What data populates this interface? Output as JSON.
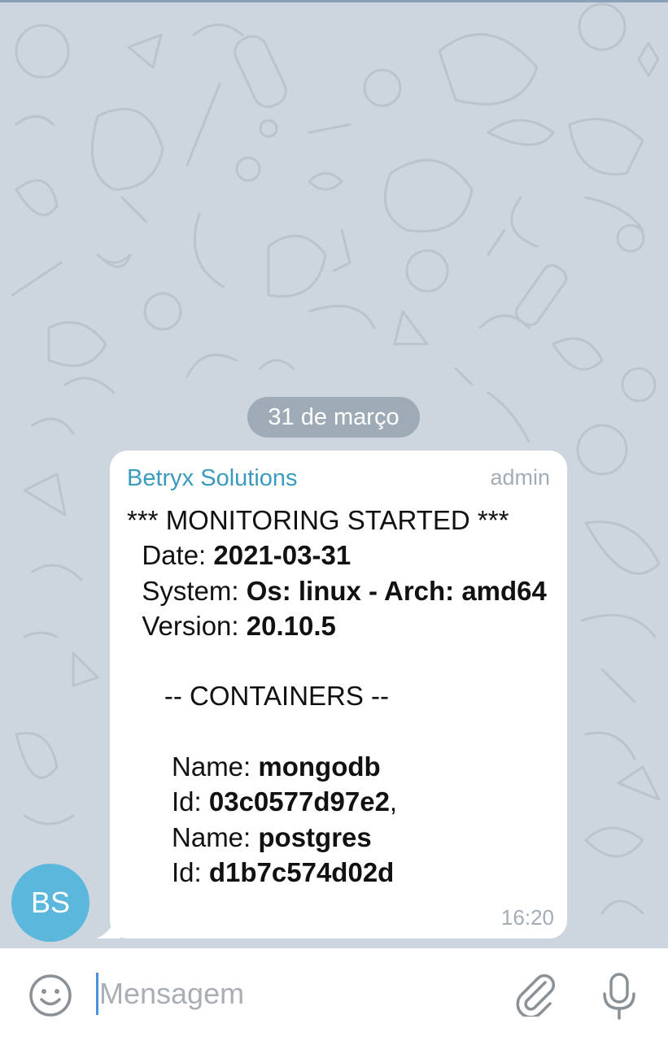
{
  "chat": {
    "date_separator": "31 de março",
    "avatar_initials": "BS",
    "message": {
      "sender": "Betryx Solutions",
      "role": "admin",
      "time": "16:20",
      "lines": [
        {
          "label": "*** MONITORING STARTED ***",
          "value": ""
        },
        {
          "label": "  Date: ",
          "value": "2021-03-31"
        },
        {
          "label": "  System: ",
          "value": "Os: linux - Arch: amd64"
        },
        {
          "label": "  Version: ",
          "value": "20.10.5"
        },
        {
          "label": "",
          "value": ""
        },
        {
          "label": "     -- CONTAINERS --",
          "value": ""
        },
        {
          "label": "",
          "value": ""
        },
        {
          "label": "      Name: ",
          "value": "mongodb"
        },
        {
          "label": "      Id: ",
          "value": "03c0577d97e2",
          "suffix": ","
        },
        {
          "label": "      Name: ",
          "value": "postgres"
        },
        {
          "label": "      Id: ",
          "value": "d1b7c574d02d"
        }
      ]
    }
  },
  "composer": {
    "placeholder": "Mensagem",
    "icons": [
      "emoji-icon",
      "paperclip-icon",
      "microphone-icon"
    ]
  },
  "colors": {
    "background": "#cdd6df",
    "sender_name": "#3a9bbd",
    "avatar": "#5cb7dd",
    "cursor": "#4a90d9"
  }
}
